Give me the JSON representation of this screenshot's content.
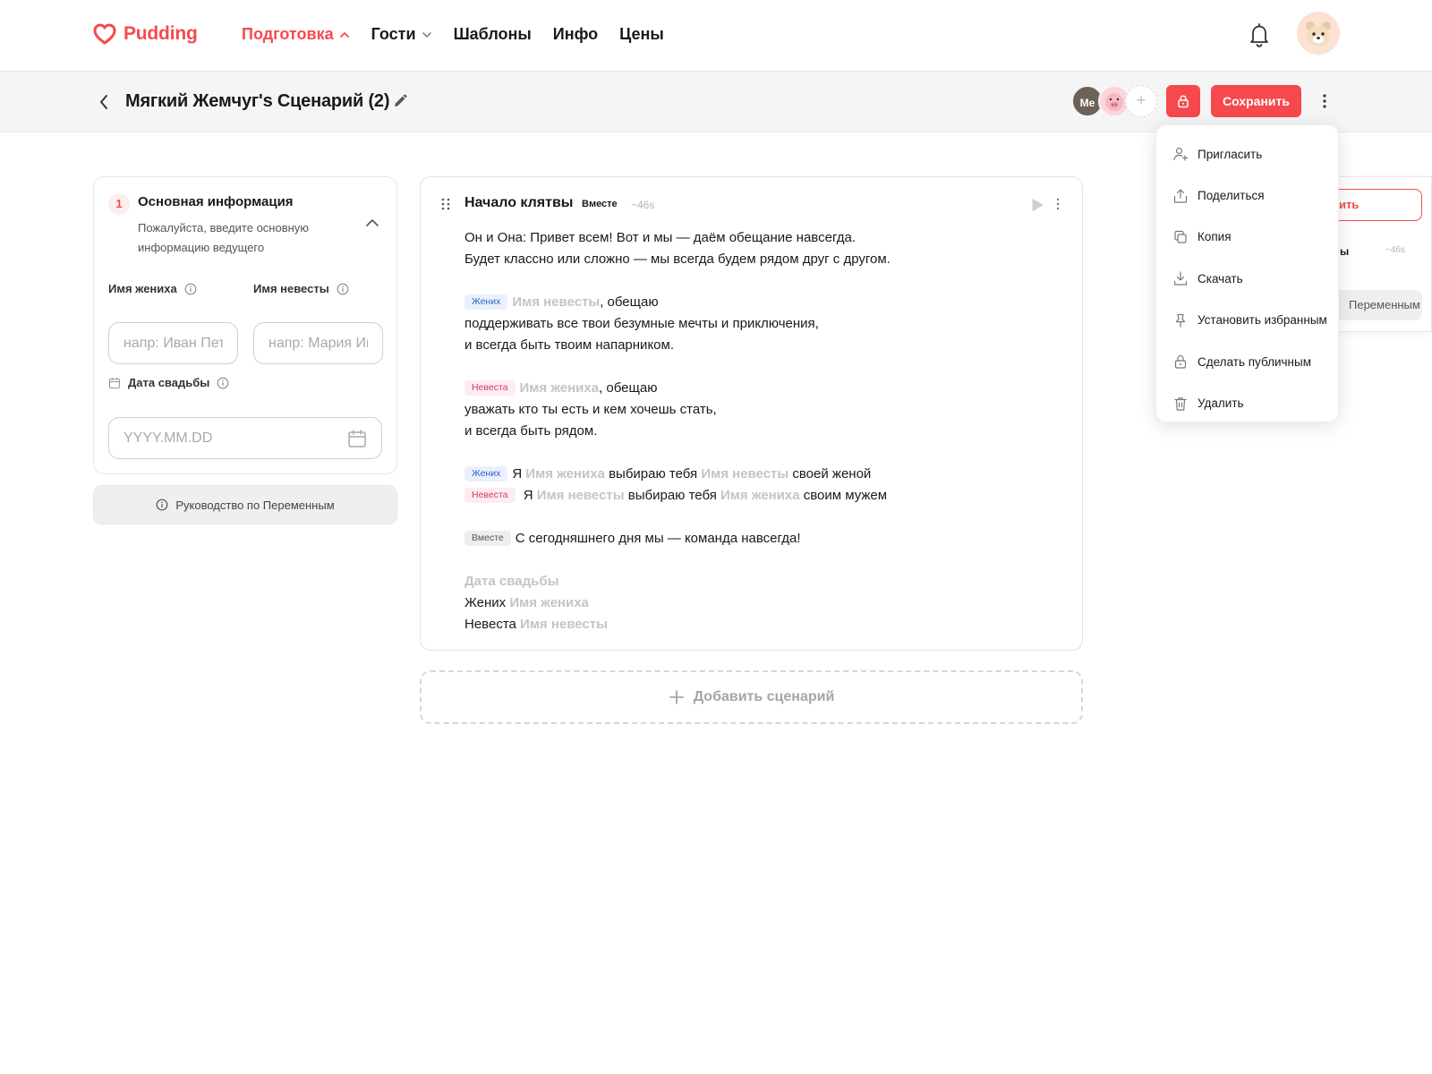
{
  "header": {
    "logo_text": "Pudding",
    "nav": [
      {
        "label": "Подготовка",
        "active": true,
        "chevron": "chevron-up-icon"
      },
      {
        "label": "Гости",
        "active": false,
        "chevron": "chevron-down-icon"
      },
      {
        "label": "Шаблоны",
        "active": false
      },
      {
        "label": "Инфо",
        "active": false
      },
      {
        "label": "Цены",
        "active": false
      }
    ],
    "icons": [
      "bell-icon",
      "bear-avatar"
    ]
  },
  "toolbar": {
    "title": "Мягкий Жемчуг's Сценарий (2)",
    "collaborator_me": "Me",
    "save_label": "Сохранить"
  },
  "info": {
    "step": "1",
    "title": "Основная информация",
    "description": "Пожалуйста, введите основную информацию ведущего",
    "groom_label": "Имя жениха",
    "groom_placeholder": "напр: Иван Петров",
    "groom_value": "",
    "bride_label": "Имя невесты",
    "bride_placeholder": "напр: Мария Иванова",
    "bride_value": "",
    "date_label": "Дата свадьбы",
    "date_placeholder": "YYYY.MM.DD",
    "date_value": "",
    "guide_label": "Руководство по Переменным"
  },
  "script": {
    "title": "Начало клятвы",
    "badge": "Вместе",
    "duration": "~46s",
    "tags": {
      "groom": "Жених",
      "bride": "Невеста",
      "together": "Вместе"
    },
    "vars": {
      "groom_name": "Имя жениха",
      "bride_name": "Имя невесты",
      "wedding_date": "Дата свадьбы"
    },
    "p1_l1": "Он и Она: Привет всем! Вот и мы — даём обещание навсегда.",
    "p1_l2": "Будет классно или сложно — мы всегда будем рядом друг с другом.",
    "p2_promise": ", обещаю",
    "p2_l2": "поддерживать все твои безумные мечты и приключения,",
    "p2_l3": "и всегда быть твоим напарником.",
    "p3_promise": ", обещаю",
    "p3_l2": "уважать кто ты есть и кем хочешь стать,",
    "p3_l3": "и всегда быть рядом.",
    "p4_ya": "Я",
    "p4_choose": "выбираю тебя",
    "p4_wife": "своей женой",
    "p4_husband": "своим мужем",
    "p5_text": "С сегодняшнего дня мы — команда навсегда!",
    "p6_groom": "Жених",
    "p6_bride": "Невеста",
    "add_label": "Добавить сценарий"
  },
  "side_panel": {
    "button_fragment": "вить",
    "text_fragment": "ы",
    "duration": "~46s",
    "guide_fragment": "Переменным"
  },
  "menu": {
    "items": [
      {
        "label": "Пригласить",
        "icon": "invite-user-icon"
      },
      {
        "label": "Поделиться",
        "icon": "share-icon"
      },
      {
        "label": "Копия",
        "icon": "copy-icon"
      },
      {
        "label": "Скачать",
        "icon": "download-icon"
      },
      {
        "label": "Установить избранным",
        "icon": "pin-icon"
      },
      {
        "label": "Сделать публичным",
        "icon": "lock-icon"
      },
      {
        "label": "Удалить",
        "icon": "trash-icon"
      }
    ]
  },
  "colors": {
    "accent": "#f5494e",
    "groom_tag": "#2e63c9",
    "bride_tag": "#d63a6a",
    "variable": "#c4c4c4"
  }
}
